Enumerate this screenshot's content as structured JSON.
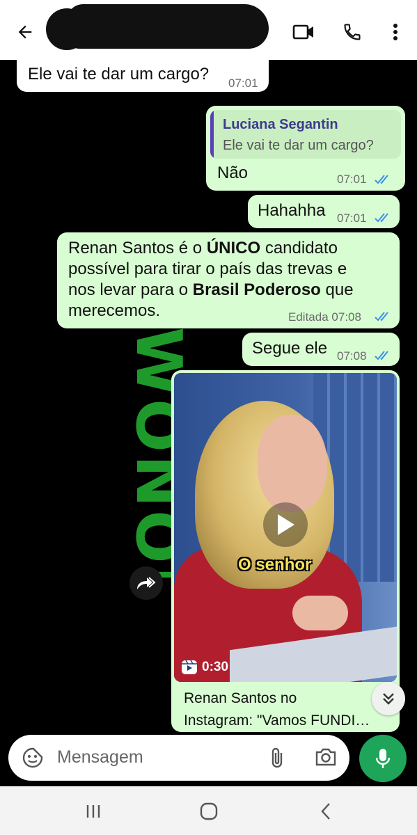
{
  "header": {
    "back_icon": "arrow-left-icon",
    "contact_name": "",
    "icons": [
      "video-call-icon",
      "phone-icon",
      "more-vert-icon"
    ]
  },
  "messages": [
    {
      "direction": "incoming",
      "text": "Ele vai te dar um cargo?",
      "time": "07:01"
    },
    {
      "direction": "outgoing",
      "quote": {
        "author": "Luciana Segantin",
        "text": "Ele vai te dar um cargo?"
      },
      "text": "Não",
      "time": "07:01",
      "status": "read"
    },
    {
      "direction": "outgoing",
      "text": "Hahahha",
      "time": "07:01",
      "status": "read"
    },
    {
      "direction": "outgoing",
      "lines": [
        [
          "Renan Santos é o ",
          "ÚNICO",
          " candidato"
        ],
        "possível para tirar o país das trevas e",
        [
          "nos levar para o ",
          "Brasil Poderoso",
          " que"
        ],
        "merecemos."
      ],
      "edited_label": "Editada",
      "time": "07:08",
      "status": "read"
    },
    {
      "direction": "outgoing",
      "text": "Segue ele",
      "time": "07:08",
      "status": "read"
    },
    {
      "direction": "outgoing",
      "type": "video_link",
      "caption": "O senhor",
      "duration": "0:30",
      "link_title_line1": "Renan Santos no",
      "link_title_line2": "Instagram: \"Vamos FUNDI…"
    }
  ],
  "composer": {
    "placeholder": "Mensagem",
    "icons": [
      "sticker-icon",
      "attach-icon",
      "camera-icon",
      "mic-icon"
    ]
  },
  "colors": {
    "outgoing_bubble": "#d8fdd2",
    "incoming_bubble": "#ffffff",
    "read_ticks": "#3b8ff0",
    "accent": "#1ea55a"
  },
  "navbar": {
    "icons": [
      "recent-apps-icon",
      "home-icon",
      "back-nav-icon"
    ]
  }
}
